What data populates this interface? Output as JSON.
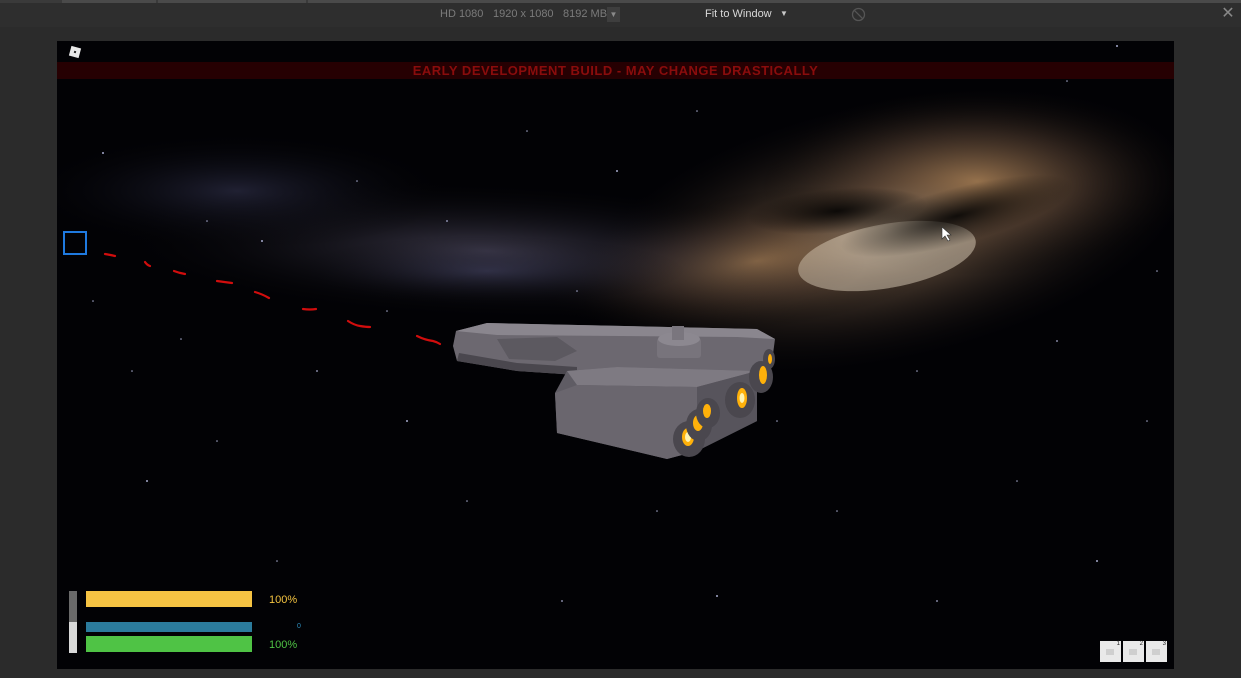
{
  "toolbar": {
    "device": "HD 1080",
    "resolution": "1920 x 1080",
    "memory": "8192 MB",
    "memory_caret_icon": "caret-down-icon",
    "zoom_mode": "Fit to Window",
    "zoom_caret_icon": "caret-down-icon",
    "orientation_icon": "rotate-disabled-icon",
    "close_icon": "close-icon"
  },
  "game": {
    "banner": "EARLY DEVELOPMENT BUILD - MAY CHANGE DRASTICALLY",
    "logo_icon": "roblox-logo-icon",
    "target_icon": "target-reticle-icon",
    "colors": {
      "banner_text": "#8a0c0c",
      "reticle": "#1f7ae0",
      "trail": "#d10d0d"
    }
  },
  "hud": {
    "shield": {
      "percent_label": "100%",
      "fill": 1.0,
      "color": "#f6c343"
    },
    "energy": {
      "value_label": "0",
      "fill": 1.0,
      "color": "#2b7b9c"
    },
    "hull": {
      "percent_label": "100%",
      "fill": 1.0,
      "color": "#4fc345"
    },
    "side_gauge_fill": 0.5
  },
  "hotbar": [
    {
      "number": "1",
      "icon": "hotbar-tool-icon"
    },
    {
      "number": "2",
      "icon": "hotbar-tool-icon"
    },
    {
      "number": "3",
      "icon": "hotbar-tool-icon"
    }
  ]
}
